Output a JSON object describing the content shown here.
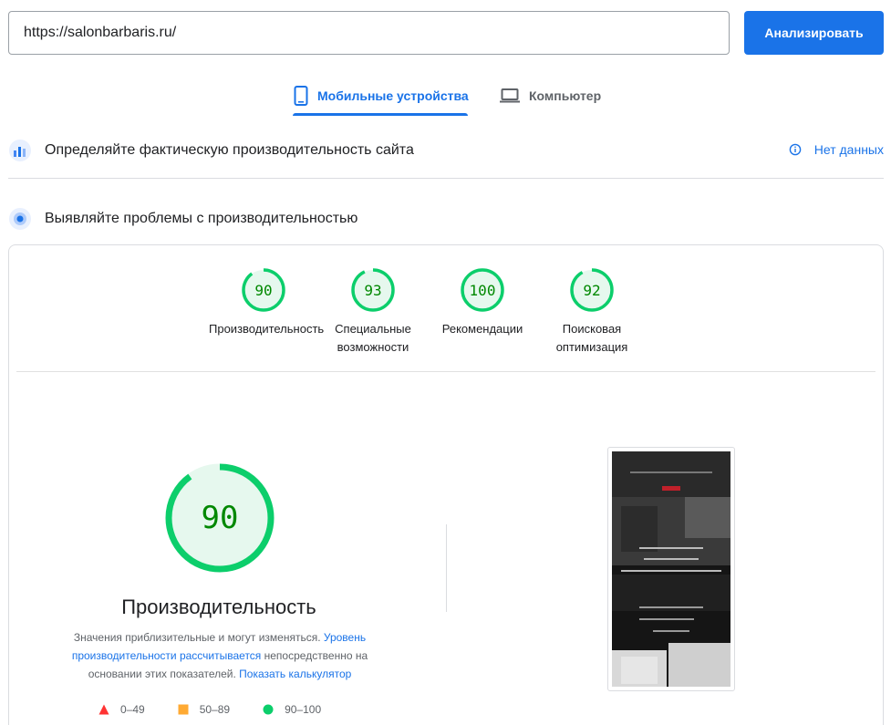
{
  "search": {
    "url": "https://salonbarbaris.ru/",
    "analyze_label": "Анализировать"
  },
  "tabs": [
    {
      "label": "Мобильные устройства",
      "icon": "smartphone-icon",
      "active": true
    },
    {
      "label": "Компьютер",
      "icon": "laptop-icon",
      "active": false
    }
  ],
  "field_data": {
    "title": "Определяйте фактическую производительность сайта",
    "status": "Нет данных"
  },
  "lab_data": {
    "title": "Выявляйте проблемы с производительностью"
  },
  "scores": [
    {
      "label": "Производительность",
      "value": "90",
      "fraction": 0.9
    },
    {
      "label": "Специальные возможности",
      "value": "93",
      "fraction": 0.93
    },
    {
      "label": "Рекомендации",
      "value": "100",
      "fraction": 1.0
    },
    {
      "label": "Поисковая оптимизация",
      "value": "92",
      "fraction": 0.92
    }
  ],
  "performance": {
    "score": "90",
    "fraction": 0.9,
    "title": "Производительность",
    "desc_1": "Значения приблизительные и могут изменяться. ",
    "desc_link_1": "Уровень производительности рассчитывается",
    "desc_2": " непосредственно на основании этих показателей. ",
    "desc_link_2": "Показать калькулятор"
  },
  "legend": [
    {
      "range": "0–49",
      "color": "#ff3333"
    },
    {
      "range": "50–89",
      "color": "#ffaa33"
    },
    {
      "range": "90–100",
      "color": "#0cce6b"
    }
  ],
  "colors": {
    "accent": "#1a73e8",
    "pass": "#0cce6b",
    "pass_bg": "#e6f8ee",
    "pass_text": "#008800"
  }
}
